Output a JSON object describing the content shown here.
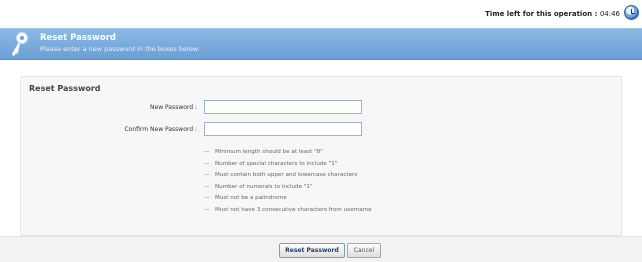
{
  "timer": {
    "label": "Time left for this operation :",
    "value": "04:46"
  },
  "header": {
    "title": "Reset Password",
    "subtitle": "Please enter a new password in the boxes below:"
  },
  "form": {
    "title": "Reset Password",
    "new_password_label": "New Password :",
    "new_password_value": "",
    "confirm_password_label": "Confirm New Password :",
    "confirm_password_value": ""
  },
  "rules": [
    "Minimum length should be at least \"8\"",
    "Number of special characters to include \"1\"",
    "Must contain both upper and lowercase characters",
    "Number of numerals to include \"1\"",
    "Must not be a palindrome",
    "Must not have 3 consecutive characters from username"
  ],
  "buttons": {
    "reset": "Reset Password",
    "cancel": "Cancel"
  },
  "colors": {
    "header": "#7aaede",
    "panel": "#f7f7f7"
  },
  "icons": {
    "header": "key-icon",
    "timer": "clock-icon"
  }
}
